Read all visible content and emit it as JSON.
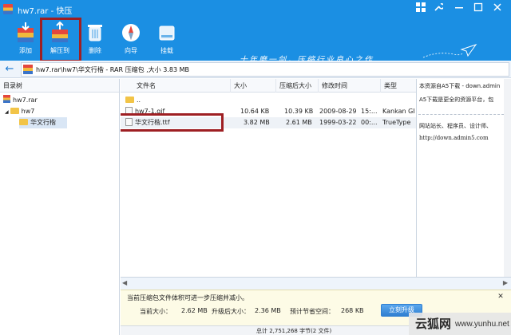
{
  "window": {
    "title": "hw7.rar - 快压",
    "controls": [
      "grid-icon",
      "settings-icon",
      "minimize-icon",
      "maximize-icon",
      "close-icon"
    ]
  },
  "toolbar": {
    "items": [
      {
        "label": "添加",
        "icon": "add-archive-icon"
      },
      {
        "label": "解压到",
        "icon": "extract-to-icon"
      },
      {
        "label": "删除",
        "icon": "trash-icon"
      },
      {
        "label": "向导",
        "icon": "compass-icon"
      },
      {
        "label": "挂载",
        "icon": "drive-icon"
      }
    ],
    "slogan": "十年磨一剑，压缩行业良心之作",
    "highlight_color": "#9e1f23",
    "bar_color": "#1b8fe3"
  },
  "address": {
    "path": "hw7.rar\\hw7\\华文行楷 - RAR 压缩包 ,大小 3.83 MB"
  },
  "tree": {
    "header": "目录树",
    "nodes": [
      {
        "label": "hw7.rar"
      },
      {
        "label": "hw7"
      },
      {
        "label": "华文行楷"
      }
    ]
  },
  "list": {
    "columns": [
      "文件名",
      "大小",
      "压缩后大小",
      "修改时间",
      "类型"
    ],
    "rows": [
      {
        "name": "..",
        "size": "",
        "packed": "",
        "date": "",
        "time": "",
        "type": ""
      },
      {
        "name": "hw7-1.gif",
        "size": "10.64 KB",
        "packed": "10.39 KB",
        "date": "2009-08-29",
        "time": "15:...",
        "type": "Kankan GI"
      },
      {
        "name": "华文行楷.ttf",
        "size": "3.82 MB",
        "packed": "2.61 MB",
        "date": "1999-03-22",
        "time": "00:...",
        "type": "TrueType"
      }
    ]
  },
  "side_panel": {
    "lines": [
      "本资源自A5下载 - down.admin",
      "A5下载是更全的资源平台，包",
      "网站站长、程序员、设计师、",
      "http://down.admin5.com"
    ]
  },
  "tip": {
    "message": "当前压缩包文件体积可进一步压缩并减小。",
    "current_size_label": "当前大小：",
    "current_size": "2.62 MB",
    "after_label": "升级后大小：",
    "after_size": "2.36 MB",
    "save_label": "预计节省空间：",
    "save_value": "268 KB",
    "button": "立刻升级"
  },
  "status": {
    "text": "总计 2,751,268 字节(2 文件)"
  },
  "watermark": {
    "brand": "云狐网",
    "url": "www.yunhu.net"
  }
}
